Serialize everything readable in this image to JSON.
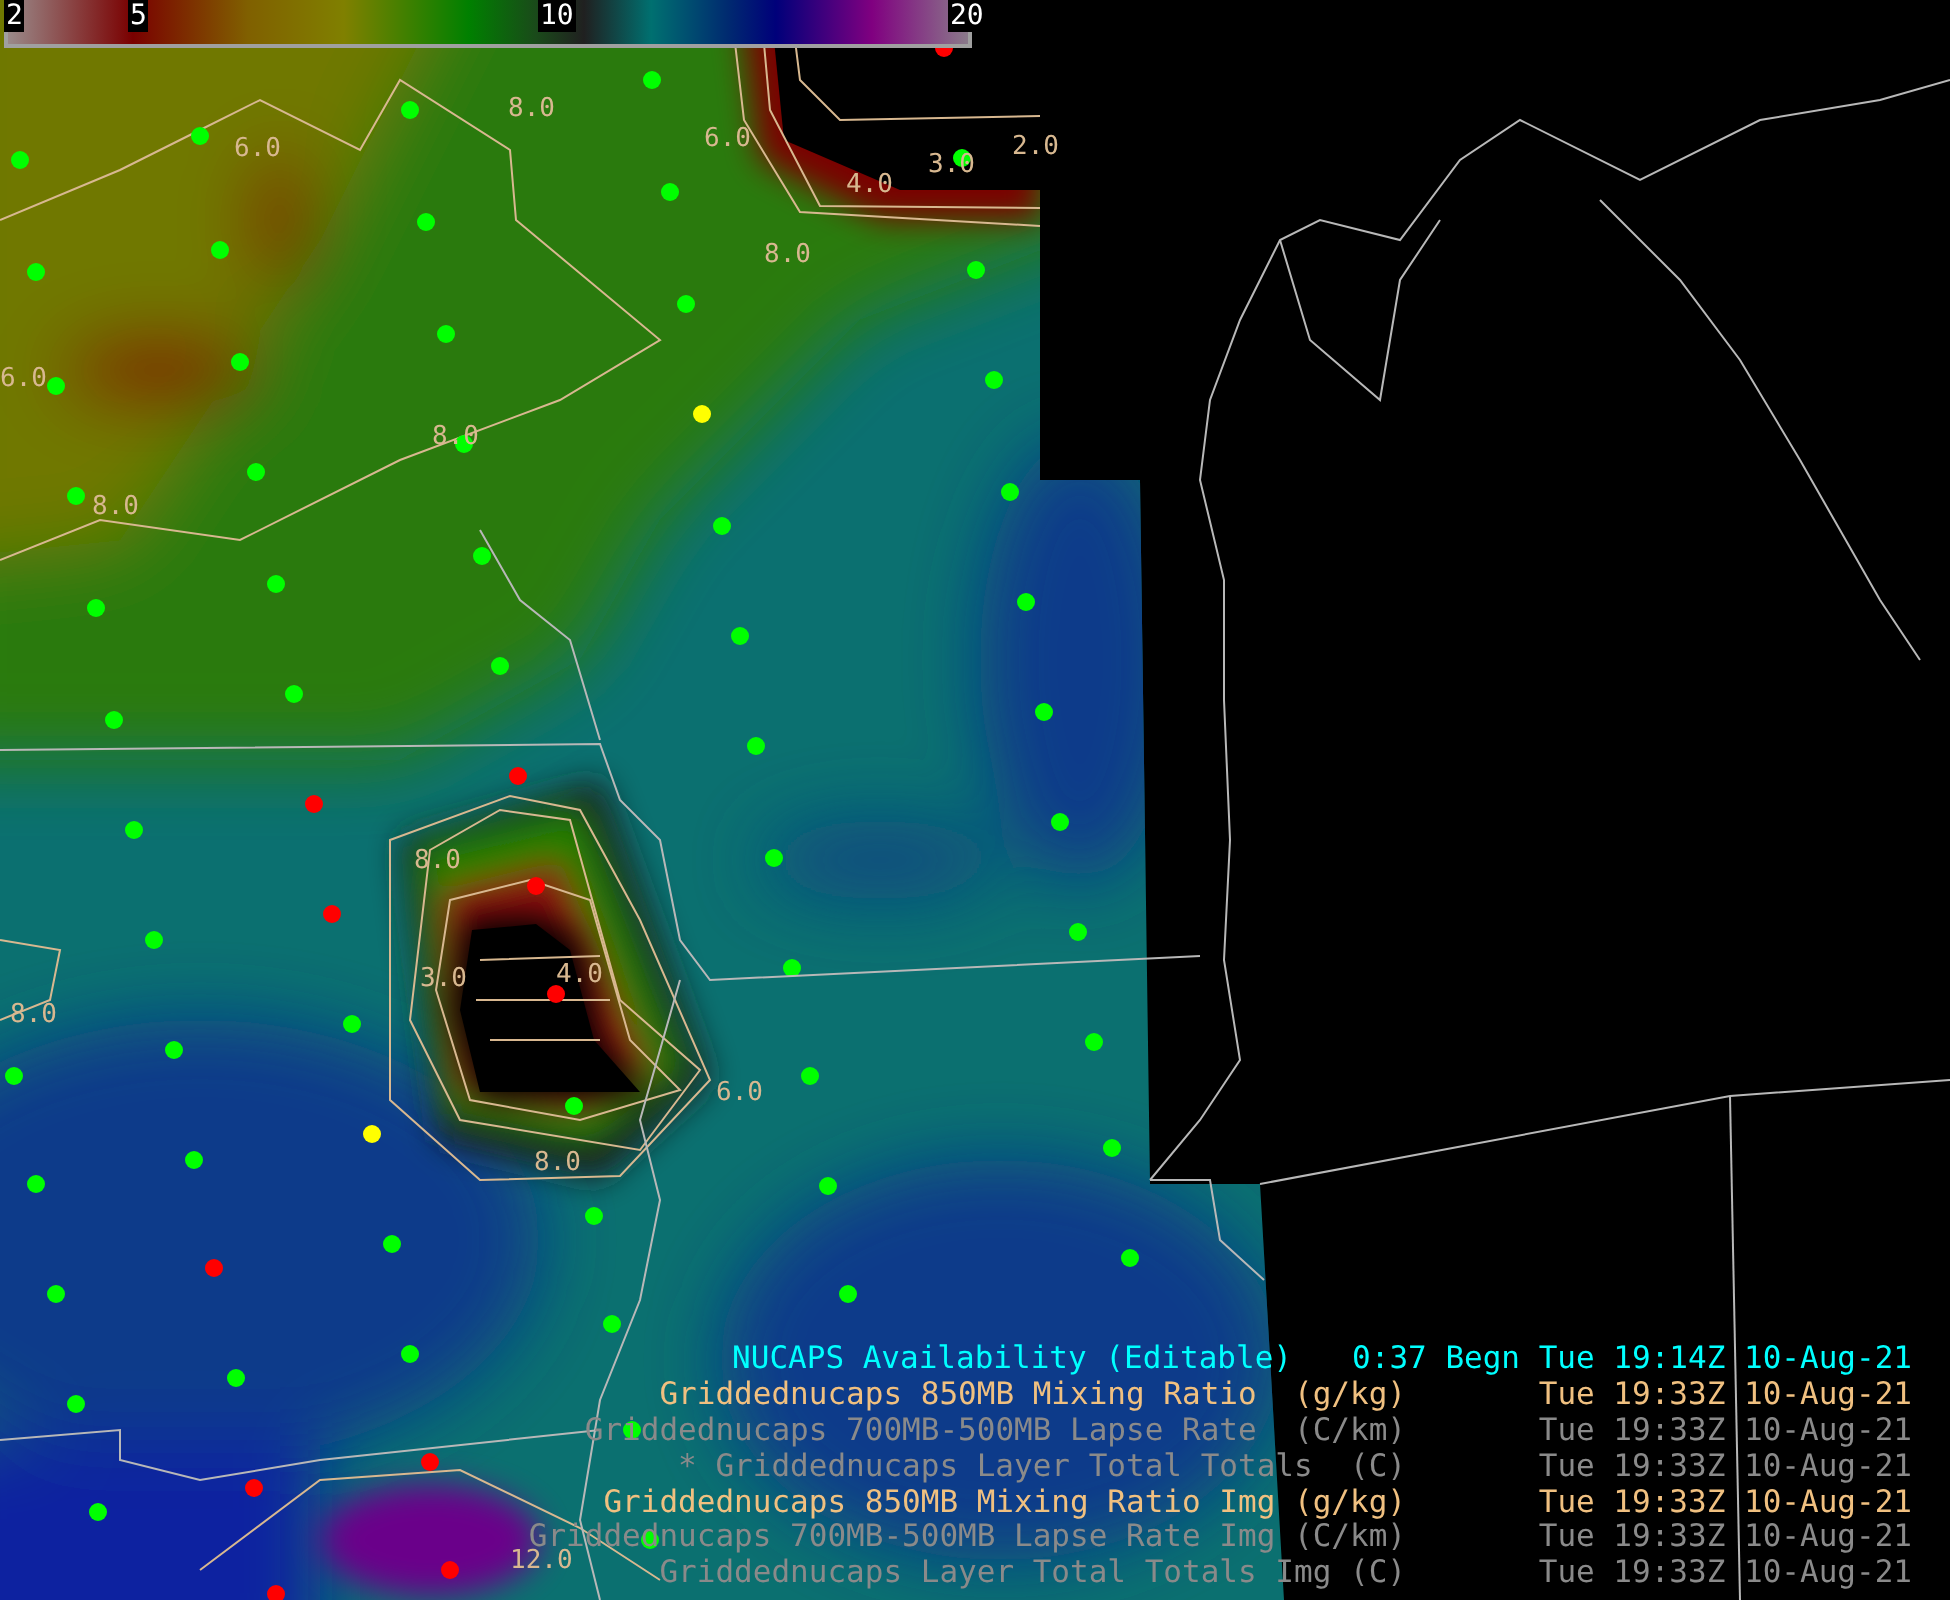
{
  "colorbar": {
    "ticks": [
      "2",
      "5",
      "10",
      "20"
    ]
  },
  "contour_labels": [
    "6.0",
    "8.0",
    "6.0",
    "4.0",
    "3.0",
    "2.0",
    "8.0",
    "6.0",
    "8.0",
    "8.0",
    "8.0",
    "3.0",
    "4.0",
    "6.0",
    "8.0",
    "8.0",
    "12.0"
  ],
  "legend": [
    {
      "name": "NUCAPS Availability (Editable)",
      "time": "0:37 Begn Tue 19:14Z 10-Aug-21",
      "color": "#00ffff"
    },
    {
      "name": "Griddednucaps 850MB Mixing Ratio  (g/kg)",
      "time": "Tue 19:33Z 10-Aug-21",
      "color": "#f0c080"
    },
    {
      "name": "Griddednucaps 700MB-500MB Lapse Rate  (C/km)",
      "time": "Tue 19:33Z 10-Aug-21",
      "color": "#8a8a8a"
    },
    {
      "name": "* Griddednucaps Layer Total Totals  (C)",
      "time": "Tue 19:33Z 10-Aug-21",
      "color": "#8a8a8a"
    },
    {
      "name": "Griddednucaps 850MB Mixing Ratio Img (g/kg)",
      "time": "Tue 19:33Z 10-Aug-21",
      "color": "#f0c080"
    },
    {
      "name": "Griddednucaps 700MB-500MB Lapse Rate Img (C/km)",
      "time": "Tue 19:33Z 10-Aug-21",
      "color": "#8a8a8a"
    },
    {
      "name": "Griddednucaps Layer Total Totals Img (C)",
      "time": "Tue 19:33Z 10-Aug-21",
      "color": "#8a8a8a"
    }
  ]
}
